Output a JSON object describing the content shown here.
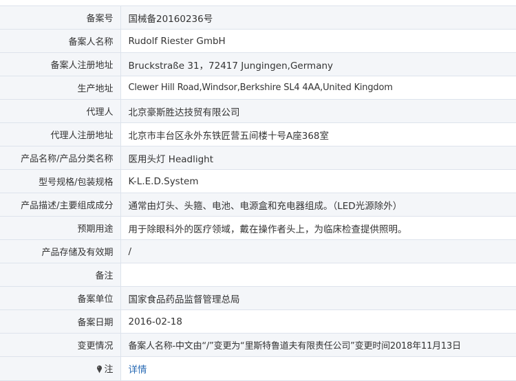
{
  "rows": [
    {
      "label": "备案号",
      "value": "国械备20160236号"
    },
    {
      "label": "备案人名称",
      "value": "Rudolf Riester GmbH"
    },
    {
      "label": "备案人注册地址",
      "value": "Bruckstraße 31，72417 Jungingen,Germany"
    },
    {
      "label": "生产地址",
      "value": "Clewer Hill Road,Windsor,Berkshire SL4 4AA,United Kingdom"
    },
    {
      "label": "代理人",
      "value": "北京豪斯胜达技贸有限公司"
    },
    {
      "label": "代理人注册地址",
      "value": "北京市丰台区永外东铁匠营五间楼十号A座368室"
    },
    {
      "label": "产品名称/产品分类名称",
      "value": "医用头灯 Headlight"
    },
    {
      "label": "型号规格/包装规格",
      "value": "K-L.E.D.System"
    },
    {
      "label": "产品描述/主要组成成分",
      "value": "通常由灯头、头箍、电池、电源盒和充电器组成。（LED光源除外）"
    },
    {
      "label": "预期用途",
      "value": "用于除眼科外的医疗领域，戴在操作者头上，为临床检查提供照明。"
    },
    {
      "label": "产品存储及有效期",
      "value": "/"
    },
    {
      "label": "备注",
      "value": ""
    },
    {
      "label": "备案单位",
      "value": "国家食品药品监督管理总局"
    },
    {
      "label": "备案日期",
      "value": "2016-02-18"
    },
    {
      "label": "变更情况",
      "value": "备案人名称-中文由“/”变更为“里斯特鲁道夫有限责任公司”变更时间2018年11月13日"
    }
  ],
  "note": {
    "label": "注",
    "icon": "pin-icon",
    "link_text": "详情",
    "link_color": "#2b6cb5"
  }
}
